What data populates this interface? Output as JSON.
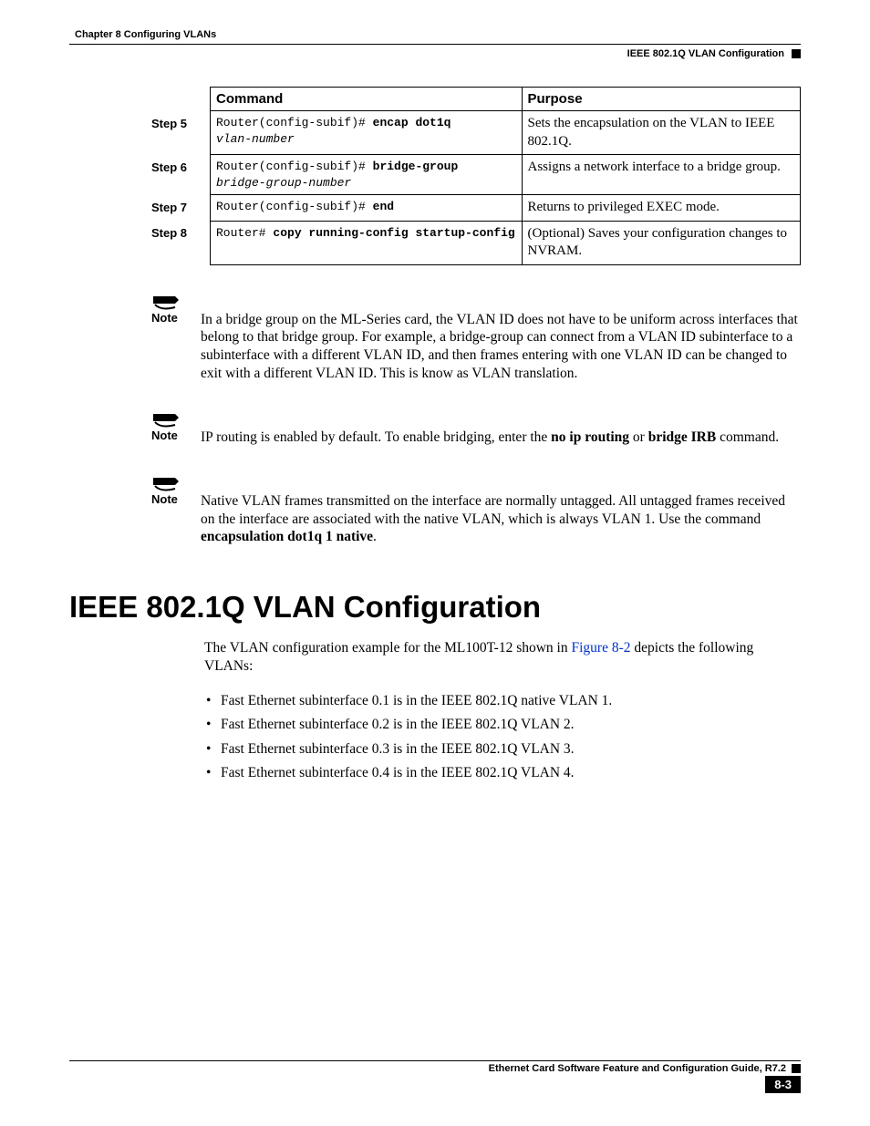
{
  "header": {
    "chapter": "Chapter 8    Configuring VLANs",
    "section": "IEEE 802.1Q VLAN Configuration"
  },
  "table": {
    "col_command": "Command",
    "col_purpose": "Purpose",
    "rows": [
      {
        "step": "Step 5",
        "prompt": "Router(config-subif)# ",
        "bold": "encap dot1q",
        "italic": "vlan-number",
        "purpose": "Sets the encapsulation on the VLAN to IEEE 802.1Q."
      },
      {
        "step": "Step 6",
        "prompt": "Router(config-subif)# ",
        "bold": "bridge-group",
        "italic": "bridge-group-number",
        "purpose": "Assigns a network interface to a bridge group."
      },
      {
        "step": "Step 7",
        "prompt": "Router(config-subif)# ",
        "bold": "end",
        "italic": "",
        "purpose": "Returns to privileged EXEC mode."
      },
      {
        "step": "Step 8",
        "prompt": "Router# ",
        "bold": "copy running-config startup-config",
        "italic": "",
        "purpose": "(Optional) Saves your configuration changes to NVRAM."
      }
    ]
  },
  "notes": {
    "label": "Note",
    "n1": "In a bridge group on the ML-Series card, the VLAN ID does not have to be uniform across interfaces that belong to that bridge group. For example, a bridge-group can connect from a VLAN ID subinterface to a subinterface with a different VLAN ID, and then frames entering with one VLAN ID can be changed to exit with a different VLAN ID. This is know as VLAN translation.",
    "n2_pre": "IP routing is enabled by default. To enable bridging, enter the ",
    "n2_b1": "no ip routing",
    "n2_mid": " or ",
    "n2_b2": "bridge IRB",
    "n2_post": " command.",
    "n3_pre": "Native VLAN frames transmitted on the interface are normally untagged. All untagged frames received on the interface are associated with the native VLAN, which is always VLAN 1. Use the command ",
    "n3_bold": "encapsulation dot1q 1 native",
    "n3_post": "."
  },
  "section": {
    "heading": "IEEE 802.1Q VLAN Configuration",
    "intro_pre": "The VLAN configuration example for the ML100T-12 shown in ",
    "intro_link": "Figure 8-2",
    "intro_post": " depicts the following VLANs:",
    "bullets": [
      "Fast Ethernet subinterface 0.1 is in the IEEE 802.1Q native VLAN 1.",
      "Fast Ethernet subinterface 0.2 is in the IEEE 802.1Q VLAN 2.",
      "Fast Ethernet subinterface 0.3 is in the IEEE 802.1Q VLAN 3.",
      "Fast Ethernet subinterface 0.4 is in the IEEE 802.1Q VLAN 4."
    ]
  },
  "footer": {
    "title": "Ethernet Card Software Feature and Configuration Guide, R7.2",
    "page": "8-3"
  }
}
